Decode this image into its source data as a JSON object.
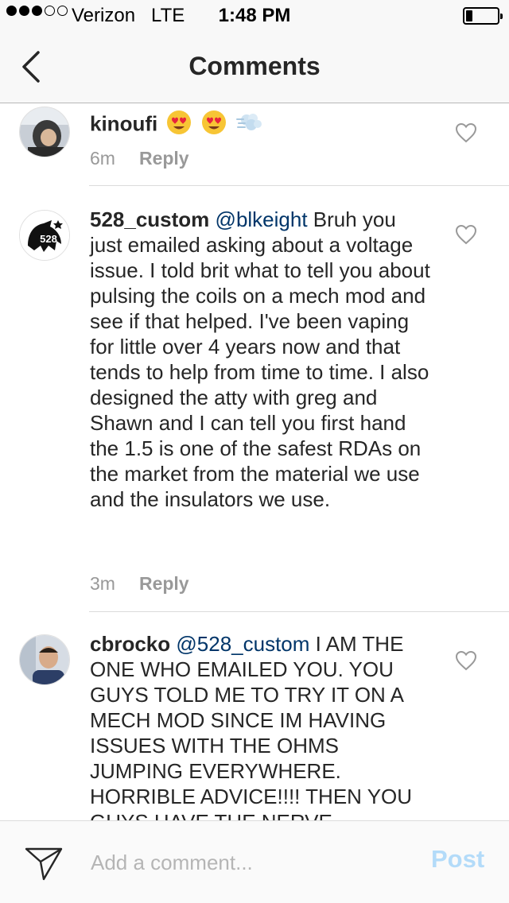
{
  "status_bar": {
    "carrier": "Verizon",
    "network": "LTE",
    "time": "1:48 PM",
    "signal_strength": 3,
    "battery_level": 0.2
  },
  "header": {
    "title": "Comments",
    "back_icon": "chevron-left-icon"
  },
  "comments": [
    {
      "username": "kinoufi",
      "mention": "",
      "text": "",
      "emojis": [
        "heart-eyes-emoji",
        "heart-eyes-emoji",
        "dash-emoji"
      ],
      "time": "6m",
      "reply_label": "Reply"
    },
    {
      "username": "528_custom",
      "mention": "@blkeight",
      "text": " Bruh you just emailed asking about a voltage issue. I told brit what to tell you about pulsing the coils on a mech mod and see if that helped. I've been vaping for little over 4 years now and that tends to help from time to time. I also designed the atty with greg and Shawn and I can tell you first hand the 1.5 is one of the safest RDAs on the market from the material we use and the insulators we use.",
      "time": "3m",
      "reply_label": "Reply",
      "avatar_logo_text": "528"
    },
    {
      "username": "cbrocko",
      "mention": "@528_custom",
      "text": " I AM THE ONE WHO EMAILED YOU. YOU GUYS TOLD ME TO TRY IT ON A MECH MOD SINCE IM HAVING ISSUES WITH THE OHMS JUMPING EVERYWHERE. HORRIBLE ADVICE!!!! THEN YOU GUYS HAVE THE NERVE"
    }
  ],
  "composer": {
    "placeholder": "Add a comment...",
    "post_label": "Post",
    "send_icon": "paper-plane-icon"
  },
  "colors": {
    "mention": "#003569",
    "post_disabled": "#b3dbf9",
    "meta_gray": "#999999"
  }
}
